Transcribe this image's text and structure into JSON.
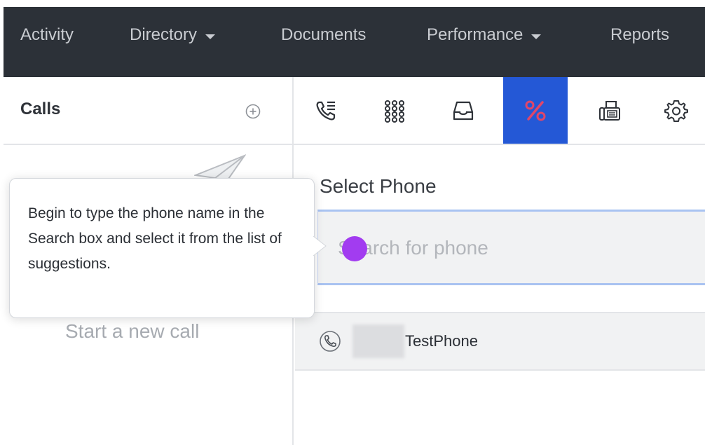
{
  "nav": {
    "items": [
      {
        "label": "Activity",
        "dropdown": false
      },
      {
        "label": "Directory",
        "dropdown": true
      },
      {
        "label": "Documents",
        "dropdown": false
      },
      {
        "label": "Performance",
        "dropdown": true
      },
      {
        "label": "Reports",
        "dropdown": false
      }
    ]
  },
  "left_panel": {
    "title": "Calls",
    "empty_state": "Start a new call"
  },
  "tooltip": {
    "text": "Begin to type the phone name in the Search box and select it from the list of suggestions."
  },
  "toolbar": {
    "tools": [
      {
        "icon": "call-list-icon",
        "active": false
      },
      {
        "icon": "dialpad-icon",
        "active": false
      },
      {
        "icon": "inbox-icon",
        "active": false
      },
      {
        "icon": "percent-icon",
        "active": true
      },
      {
        "icon": "fax-icon",
        "active": false
      },
      {
        "icon": "gear-icon",
        "active": false
      }
    ]
  },
  "main": {
    "section_title": "Select Phone",
    "search": {
      "value": "",
      "placeholder": "Search for phone"
    },
    "results": [
      {
        "label": "TestPhone",
        "icon": "phone-icon"
      }
    ]
  },
  "colors": {
    "nav_bg": "#2c3138",
    "active_tool": "#2458d6",
    "active_icon": "#e0466a",
    "cursor_dot": "#a23cf0"
  }
}
